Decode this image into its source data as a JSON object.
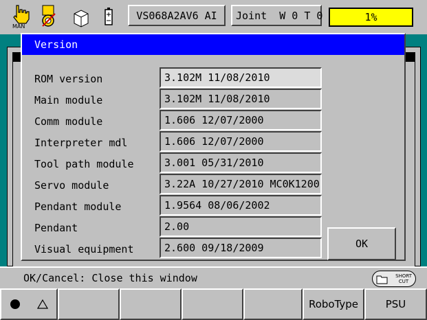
{
  "topbar": {
    "mode_icon": "hand-man-icon",
    "mode_label": "MAN",
    "robot_model": "VS068A2AV6 AI",
    "coord_mode": "Joint  W 0 T 0",
    "speed": "1%"
  },
  "dialog": {
    "title": "Version",
    "rows": [
      {
        "label": "ROM version",
        "value": "3.102M 11/08/2010"
      },
      {
        "label": "Main module",
        "value": "3.102M 11/08/2010"
      },
      {
        "label": "Comm module",
        "value": "1.606 12/07/2000"
      },
      {
        "label": "Interpreter mdl",
        "value": "1.606 12/07/2000"
      },
      {
        "label": "Tool path module",
        "value": "3.001 05/31/2010"
      },
      {
        "label": "Servo module",
        "value": "3.22A 10/27/2010 MC0K1200"
      },
      {
        "label": "Pendant module",
        "value": "1.9564 08/06/2002"
      },
      {
        "label": "Pendant",
        "value": "2.00"
      },
      {
        "label": "Visual equipment",
        "value": "2.600 09/18/2009"
      }
    ],
    "ok_label": "OK"
  },
  "status": {
    "text": "OK/Cancel: Close this window",
    "shortcut_line1": "SHORT",
    "shortcut_line2": "CUT"
  },
  "fkeys": {
    "robotype": "RoboType",
    "psu": "PSU"
  },
  "colors": {
    "title_bar": "#0000ff",
    "speed_bg": "#ffff00",
    "background": "#008080",
    "panel": "#c0c0c0"
  }
}
